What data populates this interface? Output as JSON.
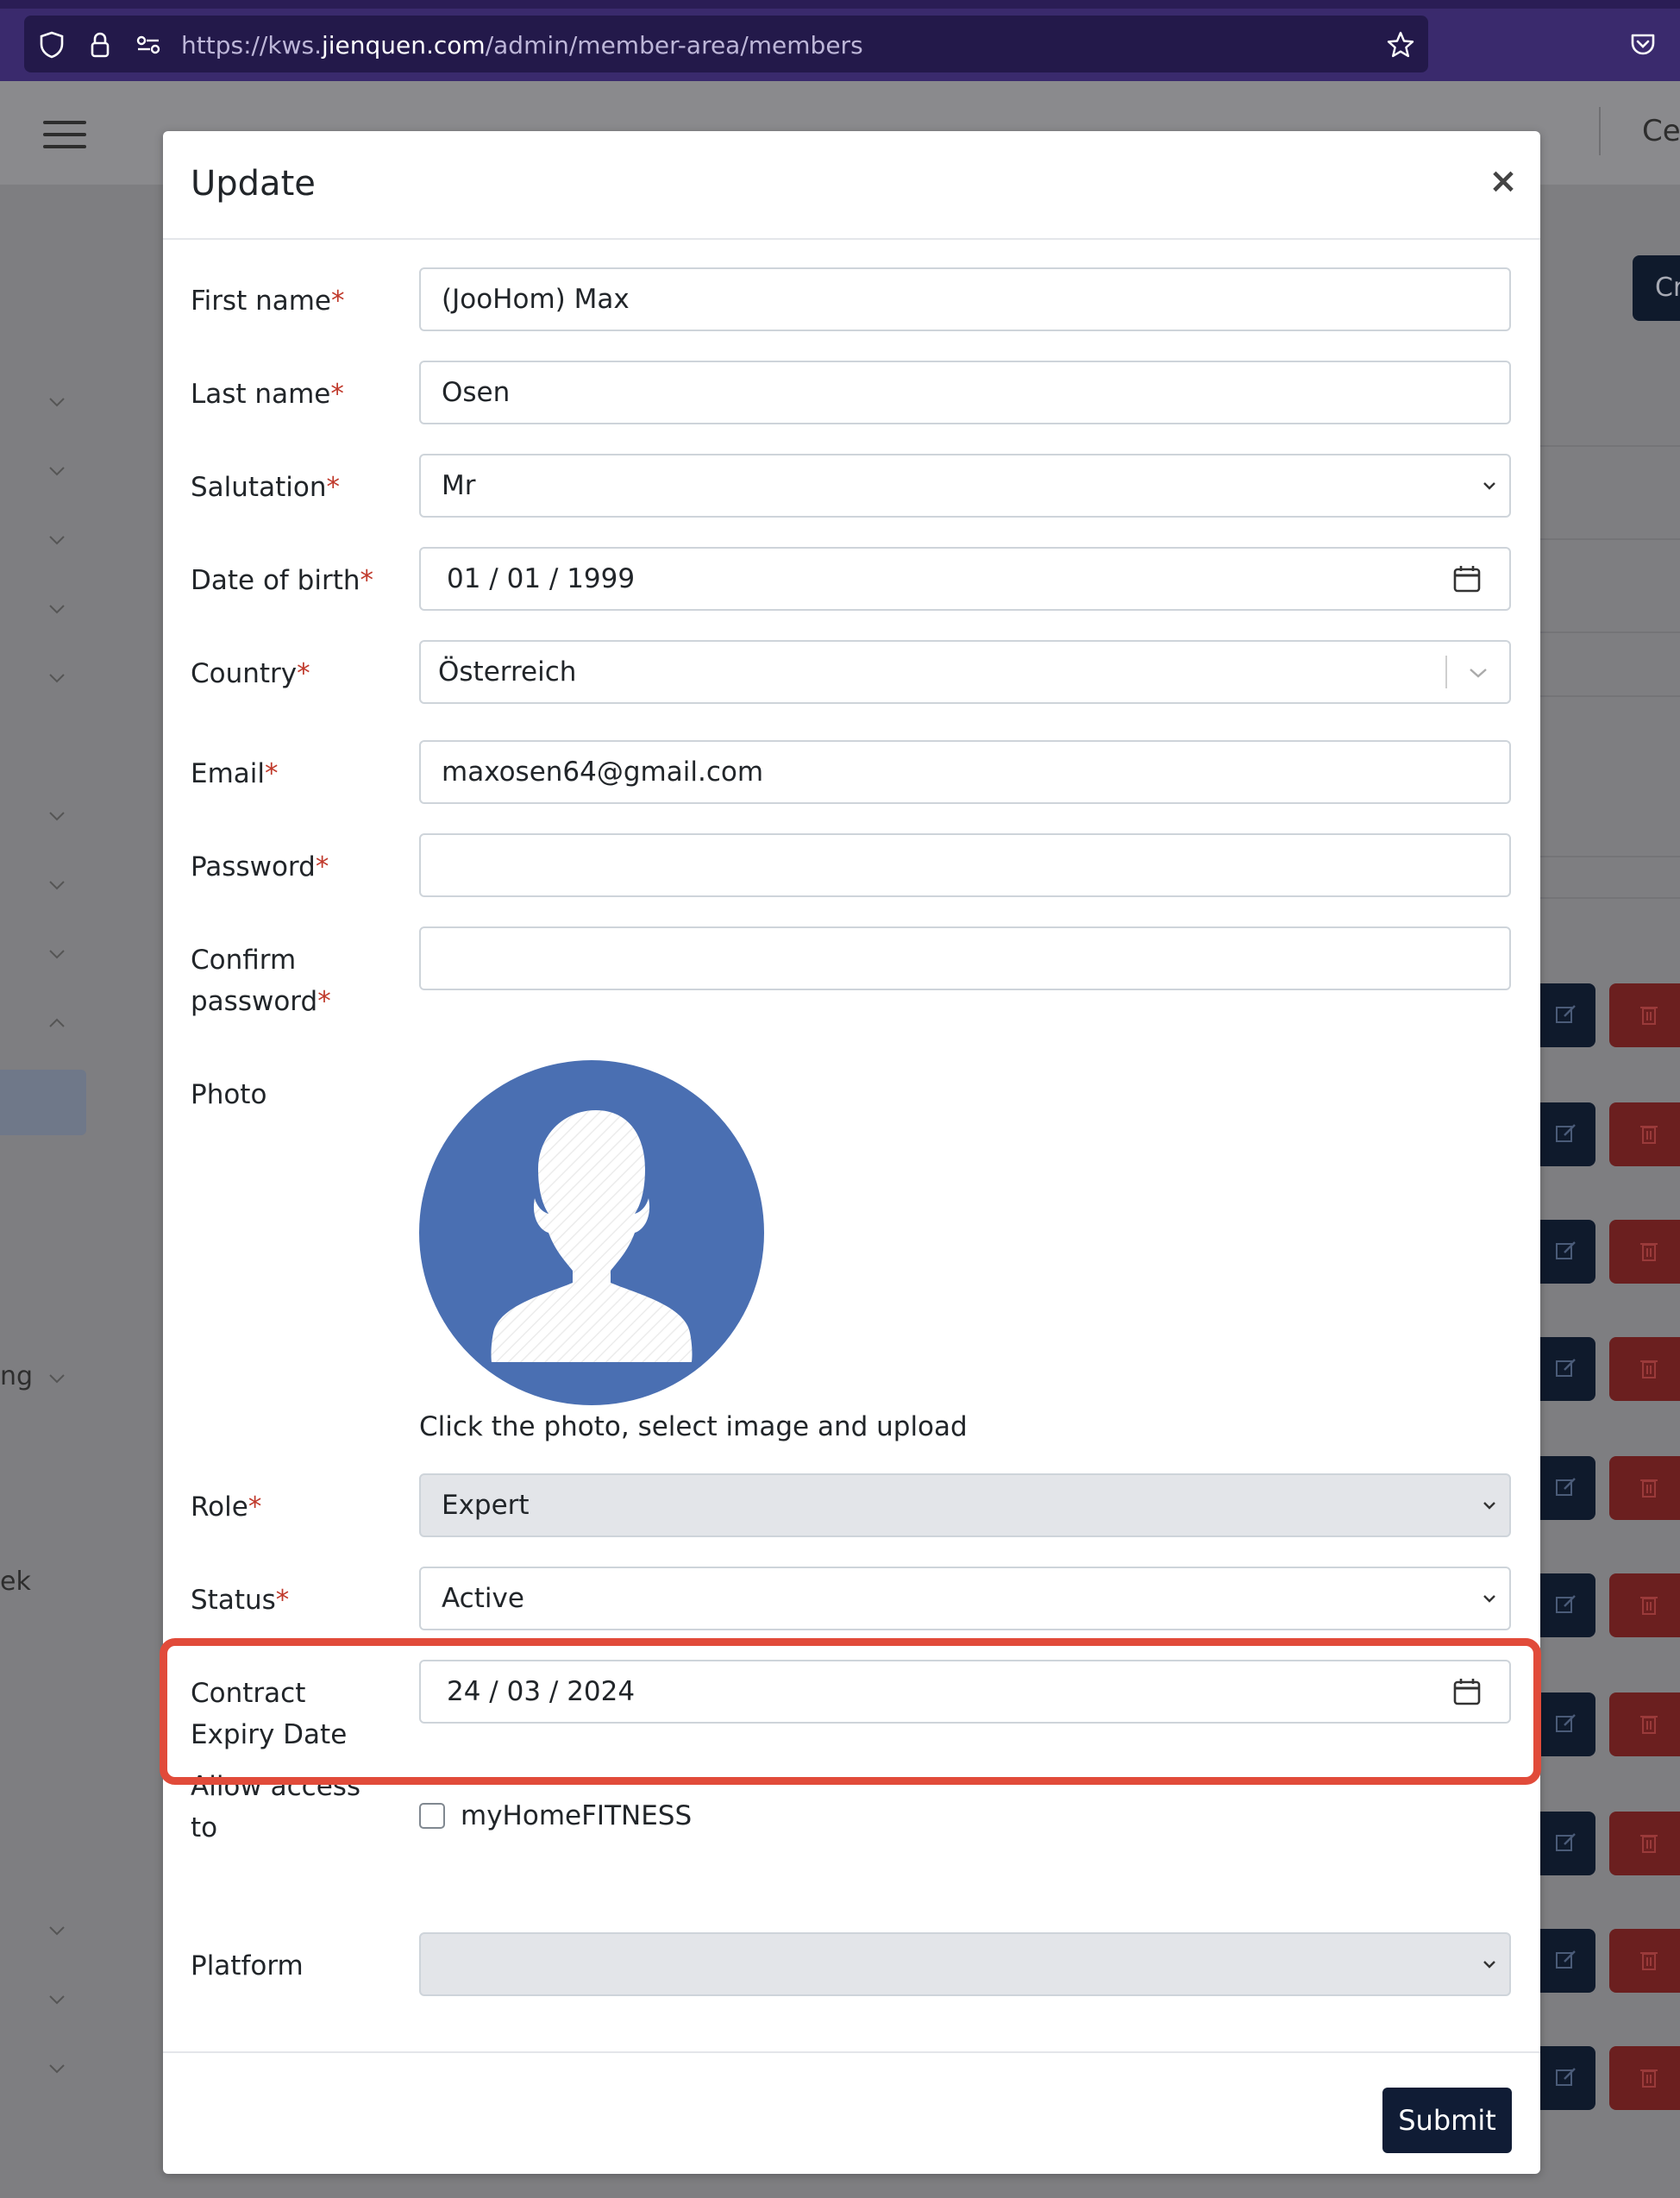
{
  "browser": {
    "url_prefix": "https://kws.",
    "url_domain": "jienquen.com",
    "url_path": "/admin/member-area/members"
  },
  "background": {
    "header_partial_text": "Cel",
    "create_partial_text": "Cr",
    "sidebar_partial_1": "ng",
    "sidebar_partial_2": "ek"
  },
  "modal": {
    "title": "Update",
    "close_symbol": "×",
    "required_marker": "*",
    "fields": {
      "first_name": {
        "label": "First name",
        "value": "(JooHom) Max"
      },
      "last_name": {
        "label": "Last name",
        "value": "Osen"
      },
      "salutation": {
        "label": "Salutation",
        "value": "Mr"
      },
      "date_of_birth": {
        "label": "Date of birth",
        "value": "01 / 01 / 1999"
      },
      "country": {
        "label": "Country",
        "value": "Österreich"
      },
      "email": {
        "label": "Email",
        "value": "maxosen64@gmail.com"
      },
      "password": {
        "label": "Password",
        "value": ""
      },
      "confirm_password": {
        "label_line1": "Confirm",
        "label_line2": "password",
        "value": ""
      },
      "photo": {
        "label": "Photo",
        "hint": "Click the photo, select image and upload"
      },
      "role": {
        "label": "Role",
        "value": "Expert"
      },
      "status": {
        "label": "Status",
        "value": "Active"
      },
      "contract_expiry": {
        "label_line1": "Contract",
        "label_line2": "Expiry Date",
        "value": "24 / 03 / 2024"
      },
      "allow_access": {
        "label_line1": "Allow access",
        "label_line2": "to",
        "option": "myHomeFITNESS",
        "checked": false
      },
      "platform": {
        "label": "Platform",
        "value": ""
      }
    },
    "submit_label": "Submit"
  },
  "colors": {
    "highlight": "#e14b3a",
    "submit_bg": "#101c35",
    "avatar_bg": "#4a6fb2",
    "required": "#c0392b"
  }
}
